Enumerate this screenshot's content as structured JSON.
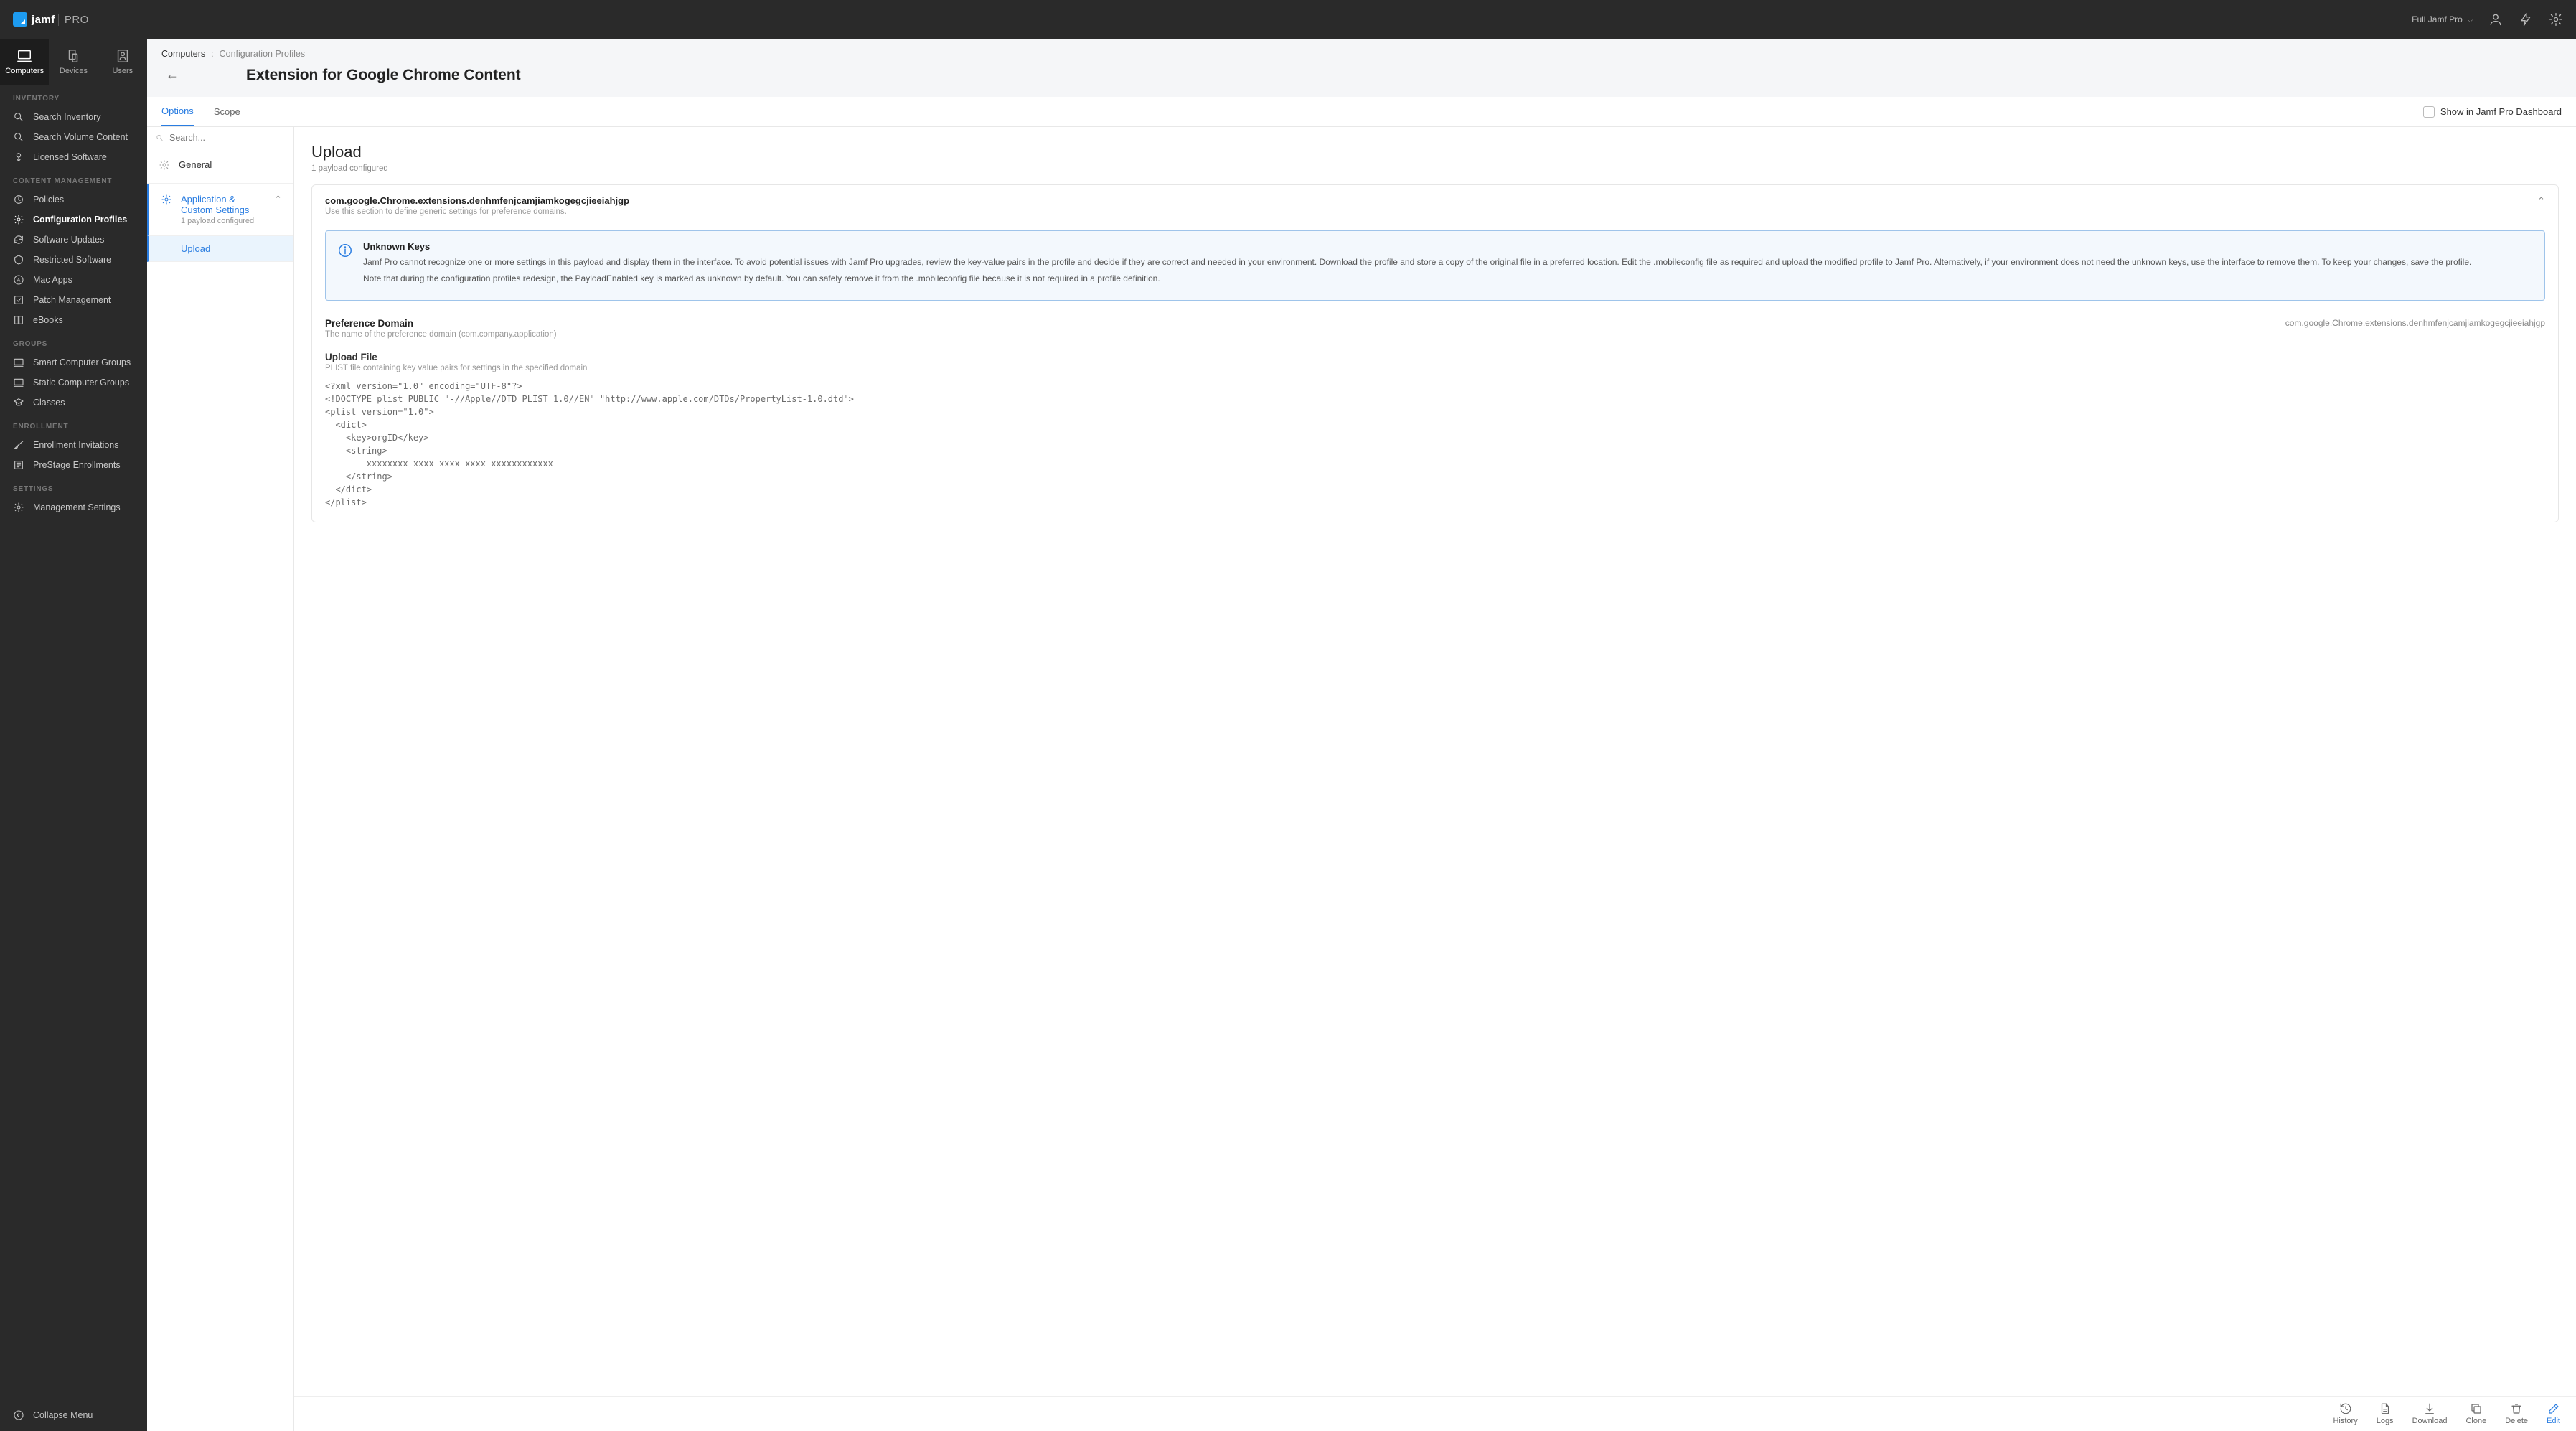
{
  "brand": {
    "name_bold": "jamf",
    "name_thin": "PRO"
  },
  "topbar": {
    "site_label": "Full Jamf Pro"
  },
  "section_tabs": {
    "computers": "Computers",
    "devices": "Devices",
    "users": "Users"
  },
  "nav": {
    "groups": [
      {
        "title": "INVENTORY",
        "items": [
          "Search Inventory",
          "Search Volume Content",
          "Licensed Software"
        ]
      },
      {
        "title": "CONTENT MANAGEMENT",
        "items": [
          "Policies",
          "Configuration Profiles",
          "Software Updates",
          "Restricted Software",
          "Mac Apps",
          "Patch Management",
          "eBooks"
        ],
        "active_index": 1
      },
      {
        "title": "GROUPS",
        "items": [
          "Smart Computer Groups",
          "Static Computer Groups",
          "Classes"
        ]
      },
      {
        "title": "ENROLLMENT",
        "items": [
          "Enrollment Invitations",
          "PreStage Enrollments"
        ]
      },
      {
        "title": "SETTINGS",
        "items": [
          "Management Settings"
        ]
      }
    ],
    "collapse": "Collapse Menu"
  },
  "breadcrumb": {
    "root": "Computers",
    "current": "Configuration Profiles"
  },
  "page": {
    "title": "Extension for Google Chrome Content"
  },
  "tabs": {
    "options": "Options",
    "scope": "Scope",
    "dashboard_toggle": "Show in Jamf Pro Dashboard"
  },
  "payload_sidebar": {
    "search_placeholder": "Search...",
    "general": "General",
    "app_custom": {
      "title": "Application & Custom Settings",
      "meta": "1 payload configured",
      "sub_upload": "Upload"
    }
  },
  "upload": {
    "heading": "Upload",
    "subtext": "1 payload configured",
    "domain_title": "com.google.Chrome.extensions.denhmfenjcamjiamkogegcjieeiahjgp",
    "domain_sub": "Use this section to define generic settings for preference domains.",
    "alert": {
      "title": "Unknown Keys",
      "p1": "Jamf Pro cannot recognize one or more settings in this payload and display them in the interface. To avoid potential issues with Jamf Pro upgrades, review the key-value pairs in the profile and decide if they are correct and needed in your environment. Download the profile and store a copy of the original file in a preferred location. Edit the .mobileconfig file as required and upload the modified profile to Jamf Pro. Alternatively, if your environment does not need the unknown keys, use the interface to remove them. To keep your changes, save the profile.",
      "p2": "Note that during the configuration profiles redesign, the PayloadEnabled key is marked as unknown by default. You can safely remove it from the .mobileconfig file because it is not required in a profile definition."
    },
    "pref_domain": {
      "label": "Preference Domain",
      "desc": "The name of the preference domain (com.company.application)",
      "value": "com.google.Chrome.extensions.denhmfenjcamjiamkogegcjieeiahjgp"
    },
    "upload_file": {
      "label": "Upload File",
      "desc": "PLIST file containing key value pairs for settings in the specified domain",
      "plist": "<?xml version=\"1.0\" encoding=\"UTF-8\"?>\n<!DOCTYPE plist PUBLIC \"-//Apple//DTD PLIST 1.0//EN\" \"http://www.apple.com/DTDs/PropertyList-1.0.dtd\">\n<plist version=\"1.0\">\n  <dict>\n    <key>orgID</key>\n    <string>\n        xxxxxxxx-xxxx-xxxx-xxxx-xxxxxxxxxxxx\n    </string>\n  </dict>\n</plist>"
    }
  },
  "actions": {
    "history": "History",
    "logs": "Logs",
    "download": "Download",
    "clone": "Clone",
    "delete": "Delete",
    "edit": "Edit"
  }
}
